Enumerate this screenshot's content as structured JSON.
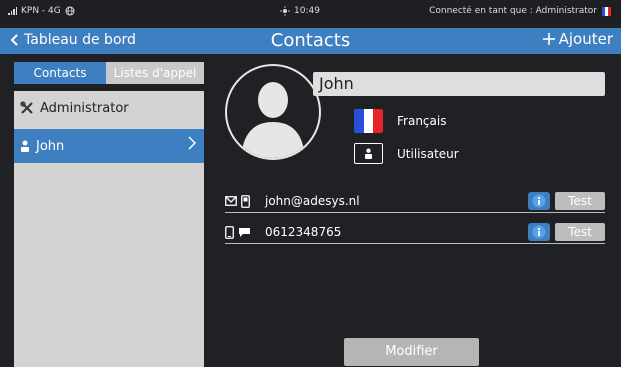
{
  "status_bar": {
    "carrier": "KPN - 4G",
    "time": "10:49",
    "connection": "Connecté en tant que : Administrator"
  },
  "nav": {
    "back_label": "Tableau de bord",
    "title": "Contacts",
    "add_label": "Ajouter"
  },
  "sidebar": {
    "tabs": [
      {
        "label": "Contacts",
        "active": true
      },
      {
        "label": "Listes d'appel",
        "active": false
      }
    ],
    "items": [
      {
        "label": "Administrator",
        "icon": "tools-icon",
        "selected": false
      },
      {
        "label": "John",
        "icon": "user-icon",
        "selected": true
      }
    ]
  },
  "contact": {
    "name": "John",
    "language": "Français",
    "role": "Utilisateur",
    "channels": [
      {
        "value": "john@adesys.nl",
        "icons": [
          "envelope-icon",
          "pager-icon"
        ],
        "action": "Test"
      },
      {
        "value": "0612348765",
        "icons": [
          "phone-icon",
          "sms-icon"
        ],
        "action": "Test"
      }
    ]
  },
  "actions": {
    "modify_label": "Modifier"
  },
  "colors": {
    "accent": "#3d7fc1",
    "background": "#1f2124",
    "panel": "#d3d3d3",
    "flag_blue": "#2a4fd6",
    "flag_white": "#ffffff",
    "flag_red": "#e5252a"
  }
}
